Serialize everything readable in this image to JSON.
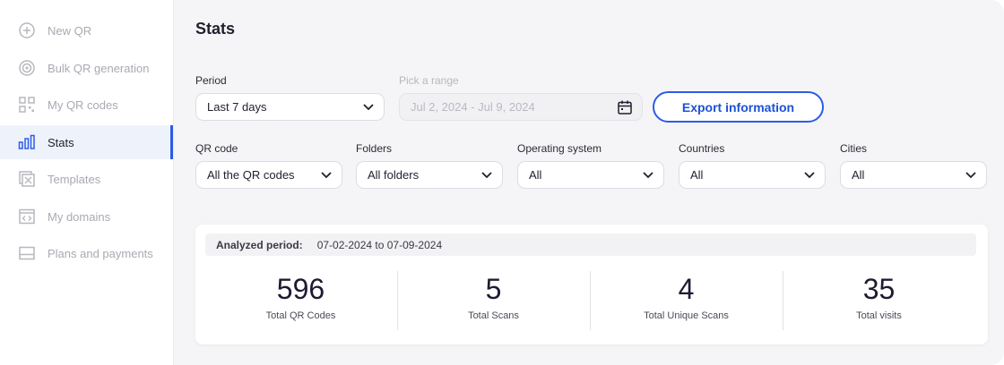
{
  "sidebar": {
    "items": [
      {
        "label": "New QR",
        "icon": "plus-circle-icon"
      },
      {
        "label": "Bulk QR generation",
        "icon": "target-icon"
      },
      {
        "label": "My QR codes",
        "icon": "qr-grid-icon"
      },
      {
        "label": "Stats",
        "icon": "bar-chart-icon",
        "active": true
      },
      {
        "label": "Templates",
        "icon": "template-icon"
      },
      {
        "label": "My domains",
        "icon": "code-window-icon"
      },
      {
        "label": "Plans and payments",
        "icon": "card-icon"
      }
    ]
  },
  "page": {
    "title": "Stats"
  },
  "filters": {
    "period": {
      "label": "Period",
      "value": "Last 7 days"
    },
    "range": {
      "label": "Pick a range",
      "value": "Jul 2, 2024 - Jul 9, 2024"
    },
    "export_label": "Export information",
    "qr_code": {
      "label": "QR code",
      "value": "All the QR codes"
    },
    "folders": {
      "label": "Folders",
      "value": "All folders"
    },
    "os": {
      "label": "Operating system",
      "value": "All"
    },
    "countries": {
      "label": "Countries",
      "value": "All"
    },
    "cities": {
      "label": "Cities",
      "value": "All"
    }
  },
  "summary": {
    "period_label": "Analyzed period:",
    "period_value": "07-02-2024 to 07-09-2024",
    "stats": [
      {
        "value": "596",
        "label": "Total QR Codes"
      },
      {
        "value": "5",
        "label": "Total Scans"
      },
      {
        "value": "4",
        "label": "Total Unique Scans"
      },
      {
        "value": "35",
        "label": "Total visits"
      }
    ]
  },
  "colors": {
    "accent": "#2b5ce6",
    "active_bg": "#eef2fb",
    "page_bg": "#f5f5f7"
  }
}
